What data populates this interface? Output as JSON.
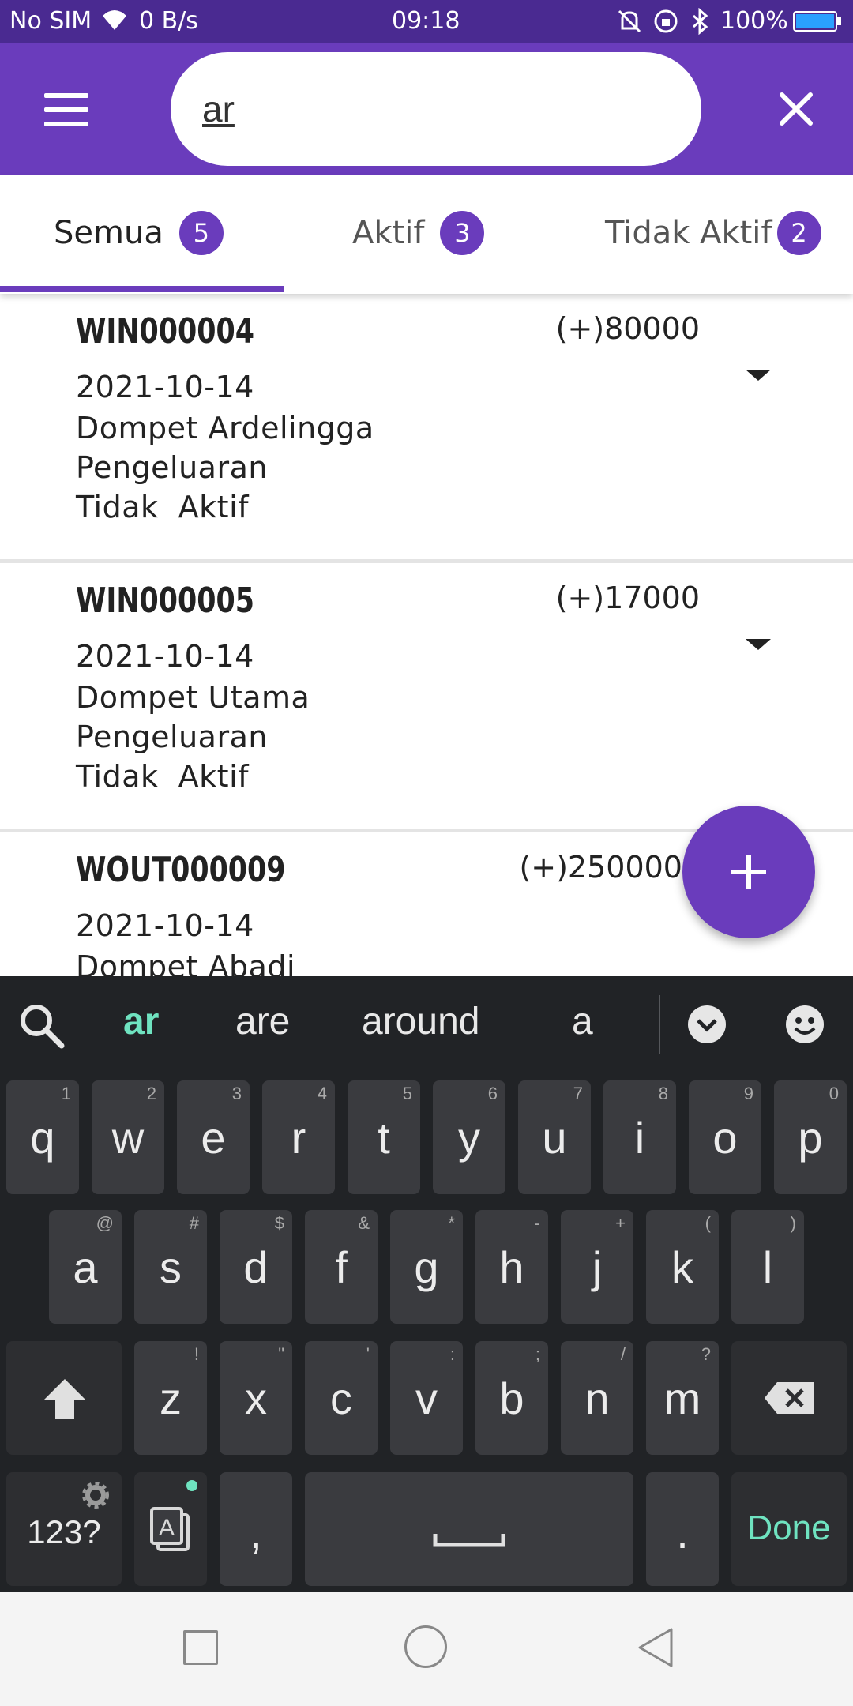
{
  "status_bar": {
    "carrier": "No SIM",
    "net_speed": "0 B/s",
    "time": "09:18",
    "battery": "100%"
  },
  "search": {
    "value": "ar"
  },
  "tabs": [
    {
      "label": "Semua",
      "count": "5",
      "active": true
    },
    {
      "label": "Aktif",
      "count": "3",
      "active": false
    },
    {
      "label": "Tidak Aktif",
      "count": "2",
      "active": false
    }
  ],
  "transactions": [
    {
      "id": "WIN000004",
      "date": "2021-10-14",
      "wallet": "Dompet Ardelingga",
      "type": "Pengeluaran",
      "status": "Tidak  Aktif",
      "amount": "(+)80000"
    },
    {
      "id": "WIN000005",
      "date": "2021-10-14",
      "wallet": "Dompet Utama",
      "type": "Pengeluaran",
      "status": "Tidak  Aktif",
      "amount": "(+)17000"
    },
    {
      "id": "WOUT000009",
      "date": "2021-10-14",
      "wallet": "Dompet Abadi",
      "amount": "(+)250000"
    }
  ],
  "keyboard": {
    "suggestions": [
      "ar",
      "are",
      "around",
      "a"
    ],
    "row1": [
      {
        "k": "q",
        "h": "1"
      },
      {
        "k": "w",
        "h": "2"
      },
      {
        "k": "e",
        "h": "3"
      },
      {
        "k": "r",
        "h": "4"
      },
      {
        "k": "t",
        "h": "5"
      },
      {
        "k": "y",
        "h": "6"
      },
      {
        "k": "u",
        "h": "7"
      },
      {
        "k": "i",
        "h": "8"
      },
      {
        "k": "o",
        "h": "9"
      },
      {
        "k": "p",
        "h": "0"
      }
    ],
    "row2": [
      {
        "k": "a",
        "h": "@"
      },
      {
        "k": "s",
        "h": "#"
      },
      {
        "k": "d",
        "h": "$"
      },
      {
        "k": "f",
        "h": "&"
      },
      {
        "k": "g",
        "h": "*"
      },
      {
        "k": "h",
        "h": "-"
      },
      {
        "k": "j",
        "h": "+"
      },
      {
        "k": "k",
        "h": "("
      },
      {
        "k": "l",
        "h": ")"
      }
    ],
    "row3": [
      {
        "k": "z",
        "h": "!"
      },
      {
        "k": "x",
        "h": "\""
      },
      {
        "k": "c",
        "h": "'"
      },
      {
        "k": "v",
        "h": ":"
      },
      {
        "k": "b",
        "h": ";"
      },
      {
        "k": "n",
        "h": "/"
      },
      {
        "k": "m",
        "h": "?"
      }
    ],
    "symbols_label": "123?",
    "comma": ",",
    "period": ".",
    "done_label": "Done"
  },
  "colors": {
    "primary": "#6a3cbc",
    "status_bar": "#4a2a91",
    "accent_green": "#6fe3c0"
  },
  "icons": [
    "menu-icon",
    "close-icon",
    "caret-down-icon",
    "add-icon",
    "search-icon",
    "collapse-icon",
    "emoji-icon",
    "shift-icon",
    "backspace-icon",
    "settings-icon",
    "clipboard-icon",
    "nav-recents-icon",
    "nav-home-icon",
    "nav-back-icon"
  ]
}
